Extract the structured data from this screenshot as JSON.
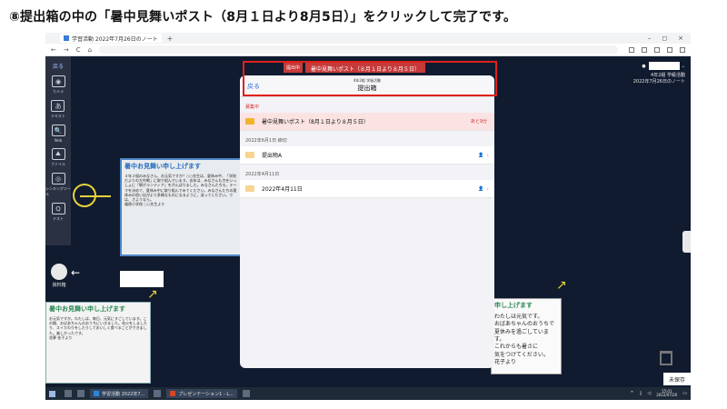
{
  "instruction": "⑧提出箱の中の「暑中見舞いポスト（8月１日より8月5日）」をクリックして完了です。",
  "browser": {
    "tab_title": "学習活動 2022年7月26日のノート",
    "tab_plus": "+",
    "window_controls": [
      "–",
      "◻",
      "×"
    ],
    "nav": [
      "←",
      "→",
      "C",
      "⌂"
    ]
  },
  "left_toolbar": {
    "back": "戻る",
    "items": [
      {
        "icon": "camera-icon",
        "glyph": "◉",
        "label": "カメラ"
      },
      {
        "icon": "text-icon",
        "glyph": "あ",
        "label": "テキスト"
      },
      {
        "icon": "web-icon",
        "glyph": "🔍",
        "label": "Web"
      },
      {
        "icon": "file-icon",
        "glyph": "⛰",
        "label": "ファイル"
      },
      {
        "icon": "thinking-tool-icon",
        "glyph": "◎",
        "label": "シンキングツール"
      },
      {
        "icon": "quiz-icon",
        "glyph": "Q",
        "label": "テスト"
      }
    ],
    "materials_label": "資料箱"
  },
  "board": {
    "banner_tag": "提出中",
    "banner_title": "暑中見舞いポスト（８月１日より８月５日）",
    "user_class": "4年2組 学級活動",
    "user_note": "2022年7月26日のノート",
    "unsaved": "未保存",
    "card_left_title": "暑中お見舞い申し上げます",
    "card_left_body": "４年２組のみなさん、お元気ですか？○○先生は、夏休み中、「学校だよりの大作戦」に取り組んでいます。去年は、みなさんも力をいっしょに「朝ボランティア」をがんばりました。みなさんたちも、テーマを決めて、夏休み中に取り組んでみてください。みなさんたちの夏休みの思い出がより多様なものになるように、送ってください。では、さようなら。",
    "card_left_sign": "福原小学校 ○○先生より",
    "card_bl_title": "暑中お見舞い申し上げます",
    "card_bl_body": "お元気ですか。わたしは、毎日、元気にすごしています。この間、おばあちゃんのおうちにいきました。花火をしましたり、スイカわりをしたりしておいしく食べることができました。楽しかったです。",
    "card_bl_sign": "花夢 花子より",
    "card_br_title": "申し上げます",
    "card_br_body": "わたしは元気です。\nおばあちゃんのおうちで\n夏休みを過ごしています。\nこれからも暑さに\n気をつけてください。",
    "card_br_sign": "花子より"
  },
  "modal": {
    "back": "戻る",
    "subtitle": "4年2組 学級活動",
    "title": "提出箱",
    "sections": [
      {
        "label": "募集中",
        "accent": "red",
        "rows": [
          {
            "label": "暑中見舞いポスト（8月１日より８月５日）",
            "remaining": "あと9分",
            "highlight": true
          }
        ]
      },
      {
        "label": "2022年6月1日 締切",
        "accent": "gray",
        "rows": [
          {
            "label": "提出物A",
            "highlight": false
          }
        ]
      },
      {
        "label": "2022年4月11日",
        "accent": "gray",
        "rows": [
          {
            "label": "2022年4月11日",
            "highlight": false
          }
        ]
      }
    ]
  },
  "taskbar": {
    "apps": [
      "学習活動 2022年7...",
      "プレゼンテーション1 - L..."
    ],
    "time": "15:01",
    "date": "2022/07/26"
  },
  "colors": {
    "highlight_frame": "#e0201c",
    "board_bg": "#101b2f",
    "modal_bg": "#f2f2f7",
    "accent_blue": "#2f6fd6"
  }
}
